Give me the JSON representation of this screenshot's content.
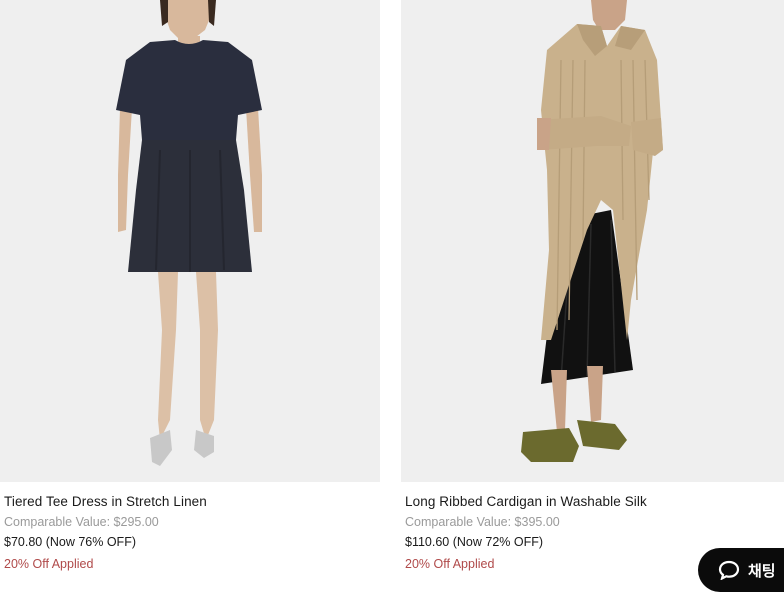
{
  "products": [
    {
      "name": "Tiered Tee Dress in Stretch Linen",
      "comparable": "Comparable Value: $295.00",
      "price": "$70.80 (Now 76% OFF)",
      "promo": "20% Off Applied",
      "image_icon": "navy-tee-dress-photo"
    },
    {
      "name": "Long Ribbed Cardigan in Washable Silk",
      "comparable": "Comparable Value: $395.00",
      "price": "$110.60 (Now 72% OFF)",
      "promo": "20% Off Applied",
      "image_icon": "beige-cardigan-photo"
    }
  ],
  "chat": {
    "label": "채팅",
    "icon": "chat-bubble-icon"
  },
  "colors": {
    "image_bg": "#efefef",
    "promo": "#b04a4a",
    "muted": "#9a9a9a",
    "chat_bg": "#0b0b0b"
  }
}
